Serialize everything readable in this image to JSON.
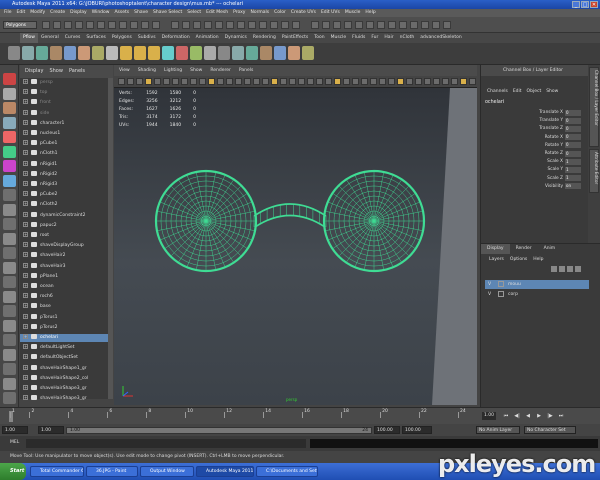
{
  "window": {
    "title": "Autodesk Maya 2011 x64: G:\\JOBURI\\photoshoptalent\\character design\\mus.mb*    ---    ochelari",
    "controls": [
      "_",
      "□",
      "✕"
    ]
  },
  "menubar": [
    "File",
    "Edit",
    "Modify",
    "Create",
    "Display",
    "Window",
    "Assets",
    "Shave",
    "Shave Select",
    "Select",
    "Edit Mesh",
    "Proxy",
    "Normals",
    "Color",
    "Create UVs",
    "Edit UVs",
    "Muscle",
    "Help"
  ],
  "statusline": {
    "mode": "Polygons"
  },
  "shelf_tabs": [
    "Pflow",
    "General",
    "Curves",
    "Surfaces",
    "Polygons",
    "Subdivs",
    "Deformation",
    "Animation",
    "Dynamics",
    "Rendering",
    "PaintEffects",
    "Toon",
    "Muscle",
    "Fluids",
    "Fur",
    "Hair",
    "nCloth",
    "advancedSkeleton"
  ],
  "shelf_active": "Pflow",
  "outliner": {
    "menu": [
      "Display",
      "Show",
      "Panels"
    ],
    "items": [
      {
        "label": "persp",
        "dim": true
      },
      {
        "label": "top",
        "dim": true
      },
      {
        "label": "front",
        "dim": true
      },
      {
        "label": "side",
        "dim": true
      },
      {
        "label": "character1"
      },
      {
        "label": "nucleus1"
      },
      {
        "label": "pCube1"
      },
      {
        "label": "nCloth1"
      },
      {
        "label": "nRigid1"
      },
      {
        "label": "nRigid2"
      },
      {
        "label": "nRigid3"
      },
      {
        "label": "pCube2"
      },
      {
        "label": "nCloth2"
      },
      {
        "label": "dynamicConstraint2"
      },
      {
        "label": "papuc2"
      },
      {
        "label": "root"
      },
      {
        "label": "shaveDisplayGroup"
      },
      {
        "label": "shaveHair2"
      },
      {
        "label": "shaveHair3"
      },
      {
        "label": "pPlane1"
      },
      {
        "label": "ocean"
      },
      {
        "label": "roch6"
      },
      {
        "label": "base"
      },
      {
        "label": "pTorus1"
      },
      {
        "label": "pTorus2"
      },
      {
        "label": "ochelari",
        "selected": true
      },
      {
        "label": "defaultLightSet"
      },
      {
        "label": "defaultObjectSet"
      },
      {
        "label": "shaveHairShape1_gr"
      },
      {
        "label": "shaveHairShape2_col"
      },
      {
        "label": "shaveHairShape3_gr"
      },
      {
        "label": "shaveHairShape3_gr"
      }
    ]
  },
  "viewport": {
    "menu": [
      "View",
      "Shading",
      "Lighting",
      "Show",
      "Renderer",
      "Panels"
    ],
    "hud": [
      {
        "label": "Verts:",
        "a": "1592",
        "b": "1580",
        "c": "0"
      },
      {
        "label": "Edges:",
        "a": "3256",
        "b": "3212",
        "c": "0"
      },
      {
        "label": "Faces:",
        "a": "1627",
        "b": "1626",
        "c": "0"
      },
      {
        "label": "Tris:",
        "a": "3174",
        "b": "3172",
        "c": "0"
      },
      {
        "label": "UVs:",
        "a": "1944",
        "b": "1840",
        "c": "0"
      }
    ],
    "camera": "persp",
    "mesh_color": "#3fdc94"
  },
  "channelbox": {
    "title": "Channel Box / Layer Editor",
    "menu": [
      "Channels",
      "Edit",
      "Object",
      "Show"
    ],
    "object": "ochelari",
    "attributes": [
      {
        "name": "Translate X",
        "value": "0"
      },
      {
        "name": "Translate Y",
        "value": "0"
      },
      {
        "name": "Translate Z",
        "value": "0"
      },
      {
        "name": "Rotate X",
        "value": "0"
      },
      {
        "name": "Rotate Y",
        "value": "0"
      },
      {
        "name": "Rotate Z",
        "value": "0"
      },
      {
        "name": "Scale X",
        "value": "1"
      },
      {
        "name": "Scale Y",
        "value": "1"
      },
      {
        "name": "Scale Z",
        "value": "1"
      },
      {
        "name": "Visibility",
        "value": "on"
      }
    ],
    "side_tabs": [
      "Channel Box / Layer Editor",
      "Attribute Editor"
    ]
  },
  "layers": {
    "tabs": [
      "Display",
      "Render",
      "Anim"
    ],
    "active_tab": "Display",
    "menu": [
      "Layers",
      "Options",
      "Help"
    ],
    "rows": [
      {
        "v": "V",
        "name": "mouu",
        "selected": true
      },
      {
        "v": "V",
        "name": "corp",
        "selected": false
      }
    ]
  },
  "timeslider": {
    "ticks": [
      "1",
      "2",
      "4",
      "6",
      "8",
      "10",
      "12",
      "14",
      "16",
      "18",
      "20",
      "22",
      "24"
    ],
    "current": "1.00"
  },
  "rangebar": {
    "start": "1.00",
    "inner_start": "1.00",
    "end_a": "24",
    "end_b": "100.00",
    "end_c": "100.00",
    "anim_layer": "No Anim Layer",
    "char_set": "No Character Set"
  },
  "cmdline": {
    "label": "MEL"
  },
  "helpline": {
    "text": "Move Tool: Use manipulator to move object(s). Use edit mode to change pivot (INSERT). Ctrl+LMB to move perpendicular."
  },
  "taskbar": {
    "start": "Start",
    "tasks": [
      {
        "label": "Total Commander 6.03 - ..."
      },
      {
        "label": "36.JPG - Paint"
      },
      {
        "label": "Output Window"
      },
      {
        "label": "Autodesk Maya 2011 ...",
        "active": true
      },
      {
        "label": "C:\\Documents and Settin..."
      }
    ]
  },
  "watermark": "pxleyes.com"
}
